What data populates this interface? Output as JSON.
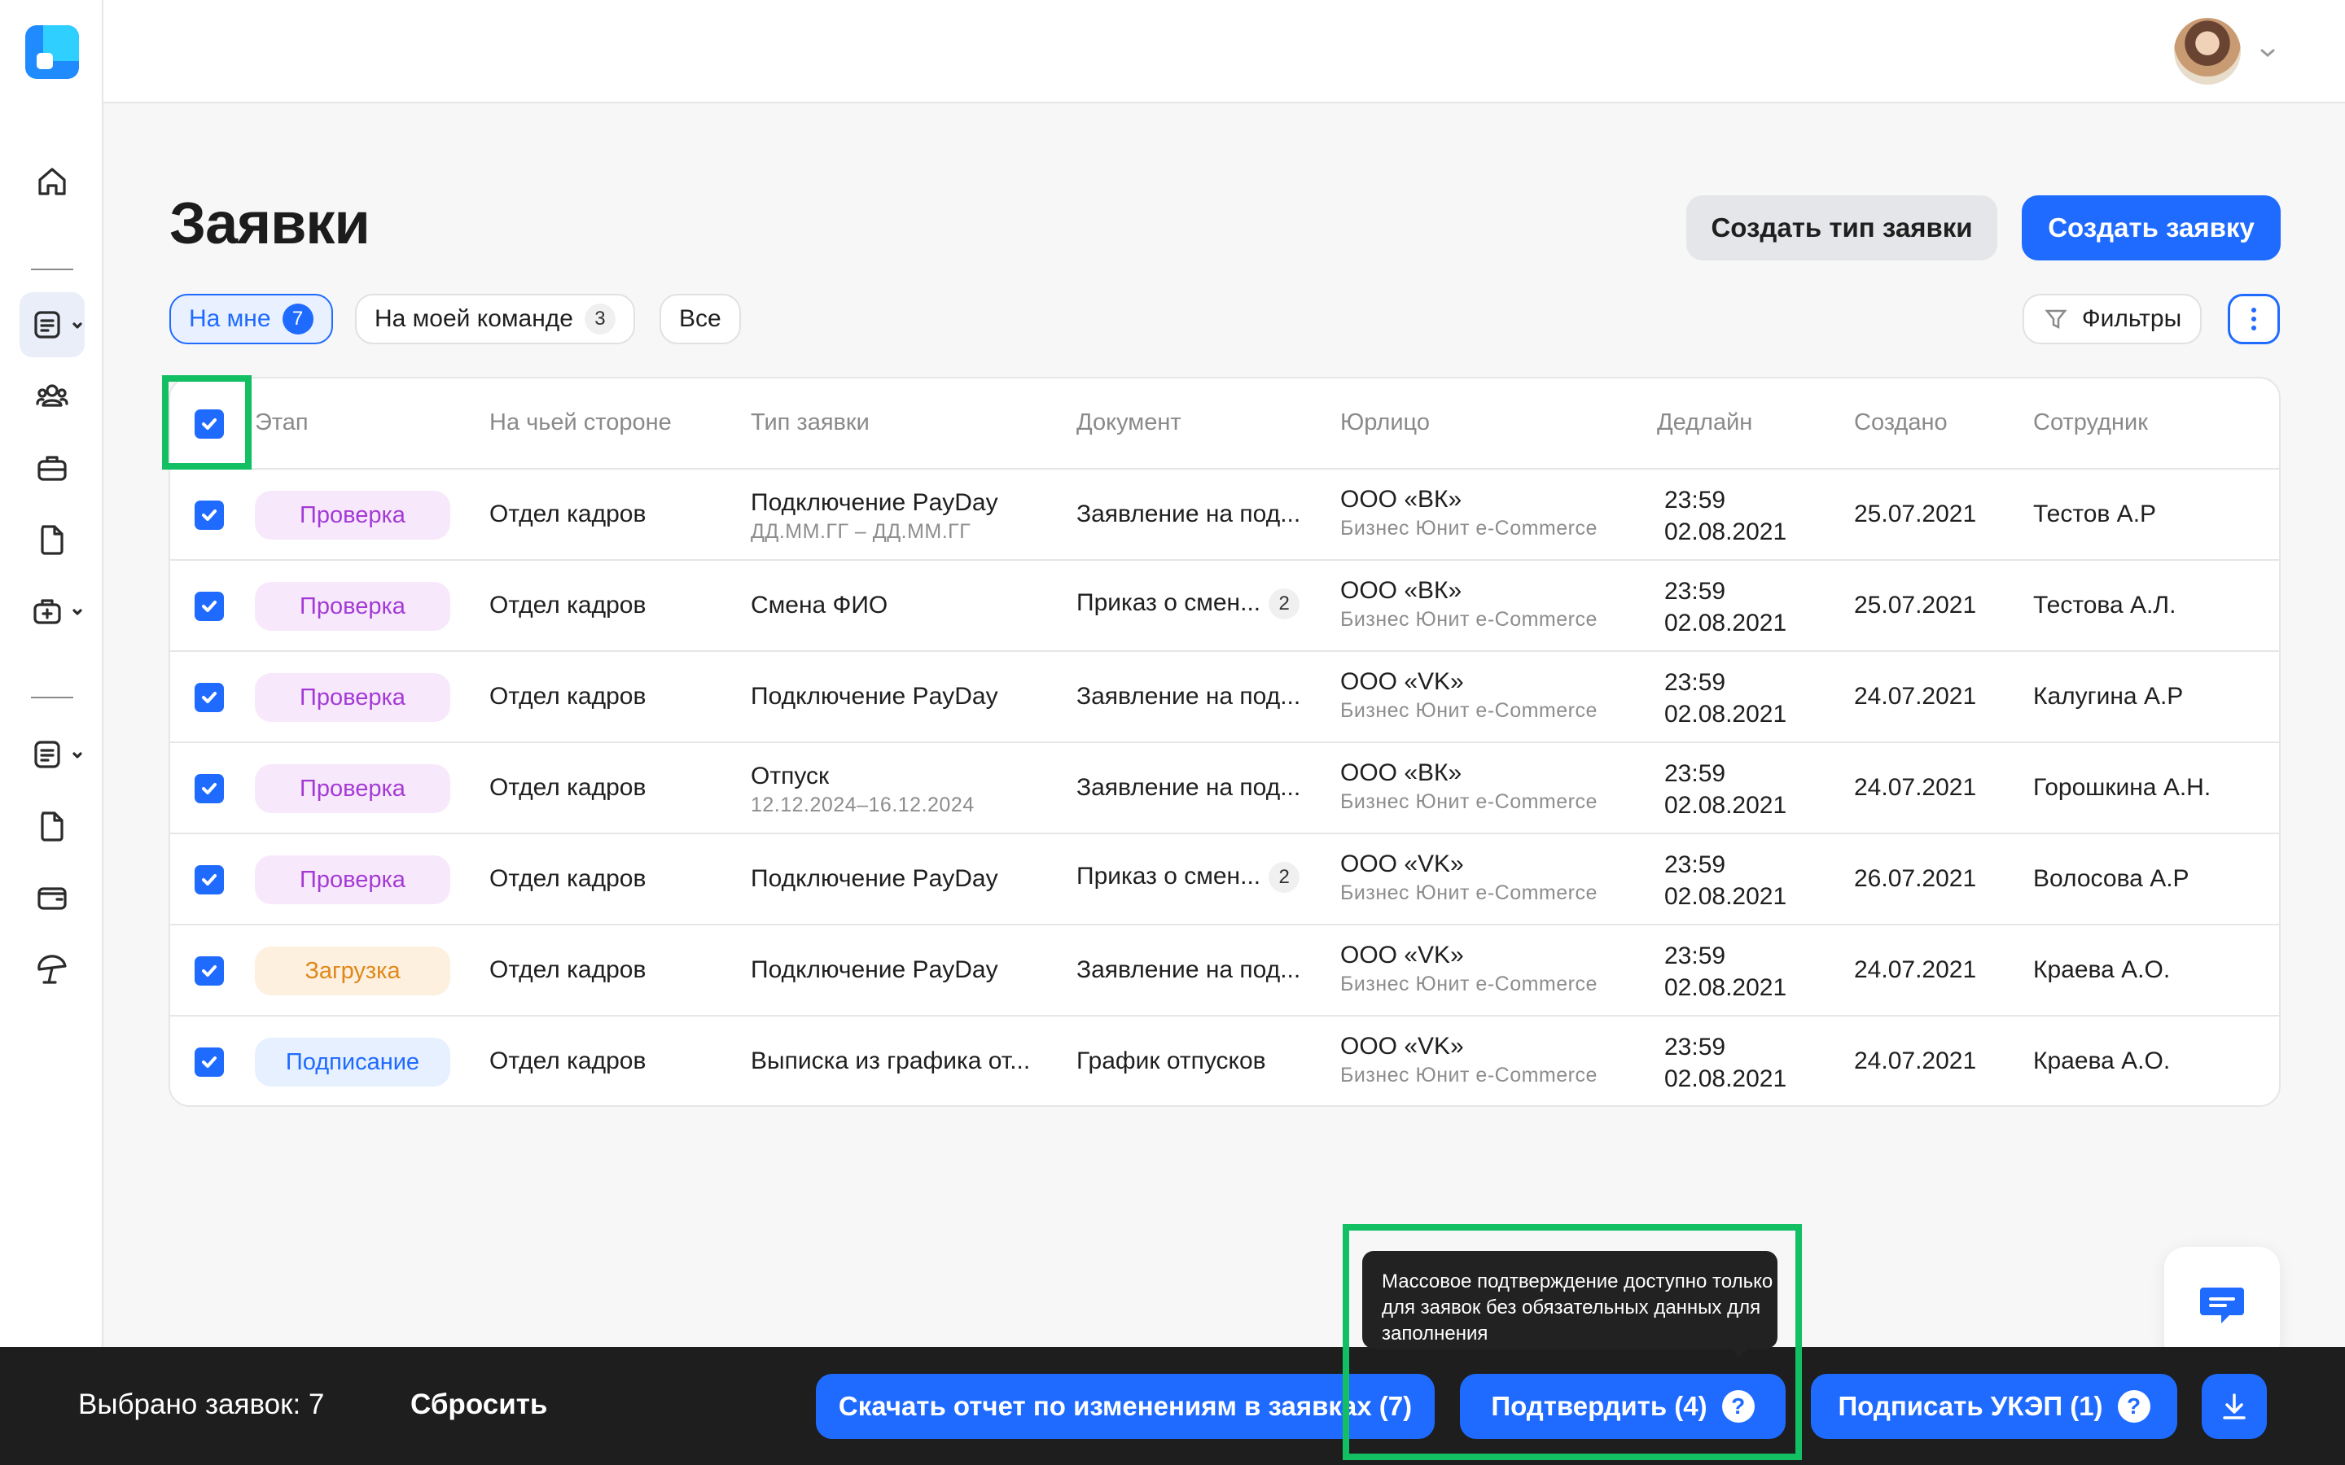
{
  "title": "Заявки",
  "header": {
    "create_type_label": "Создать тип заявки",
    "create_label": "Создать заявку"
  },
  "tabs": [
    {
      "label": "На мне",
      "count": "7"
    },
    {
      "label": "На моей команде",
      "count": "3"
    },
    {
      "label": "Все"
    }
  ],
  "filters_label": "Фильтры",
  "columns": [
    "Этап",
    "На чьей стороне",
    "Тип заявки",
    "Документ",
    "Юрлицо",
    "Дедлайн",
    "Создано",
    "Сотрудник"
  ],
  "rows": [
    {
      "stage": "Проверка",
      "side": "Отдел кадров",
      "type": "Подключение PayDay",
      "type_sub": "ДД.ММ.ГГ – ДД.ММ.ГГ",
      "doc": "Заявление на под...",
      "doc_count": "",
      "org": "ООО «ВК»",
      "org_sub": "Бизнес Юнит e-Commerce",
      "deadline_time": "23:59",
      "deadline_date": "02.08.2021",
      "created": "25.07.2021",
      "employee": "Тестов А.Р"
    },
    {
      "stage": "Проверка",
      "side": "Отдел кадров",
      "type": "Смена ФИО",
      "type_sub": "",
      "doc": "Приказ о смен...",
      "doc_count": "2",
      "org": "ООО «ВК»",
      "org_sub": "Бизнес Юнит e-Commerce",
      "deadline_time": "23:59",
      "deadline_date": "02.08.2021",
      "created": "25.07.2021",
      "employee": "Тестова А.Л."
    },
    {
      "stage": "Проверка",
      "side": "Отдел кадров",
      "type": "Подключение PayDay",
      "type_sub": "",
      "doc": "Заявление на под...",
      "doc_count": "",
      "org": "ООО «VK»",
      "org_sub": "Бизнес Юнит e-Commerce",
      "deadline_time": "23:59",
      "deadline_date": "02.08.2021",
      "created": "24.07.2021",
      "employee": "Калугина А.Р"
    },
    {
      "stage": "Проверка",
      "side": "Отдел кадров",
      "type": "Отпуск",
      "type_sub": "12.12.2024–16.12.2024",
      "doc": "Заявление на под...",
      "doc_count": "",
      "org": "ООО «ВК»",
      "org_sub": "Бизнес Юнит e-Commerce",
      "deadline_time": "23:59",
      "deadline_date": "02.08.2021",
      "created": "24.07.2021",
      "employee": "Горошкина А.Н."
    },
    {
      "stage": "Проверка",
      "side": "Отдел кадров",
      "type": "Подключение PayDay",
      "type_sub": "",
      "doc": "Приказ о смен...",
      "doc_count": "2",
      "org": "ООО «VK»",
      "org_sub": "Бизнес Юнит e-Commerce",
      "deadline_time": "23:59",
      "deadline_date": "02.08.2021",
      "created": "26.07.2021",
      "employee": "Волосова А.Р"
    },
    {
      "stage": "Загрузка",
      "side": "Отдел кадров",
      "type": "Подключение PayDay",
      "type_sub": "",
      "doc": "Заявление на под...",
      "doc_count": "",
      "org": "ООО «VK»",
      "org_sub": "Бизнес Юнит e-Commerce",
      "deadline_time": "23:59",
      "deadline_date": "02.08.2021",
      "created": "24.07.2021",
      "employee": "Краева А.О."
    },
    {
      "stage": "Подписание",
      "side": "Отдел кадров",
      "type": "Выписка из графика от...",
      "type_sub": "",
      "doc": "График отпусков",
      "doc_count": "",
      "org": "ООО «VK»",
      "org_sub": "Бизнес Юнит e-Commerce",
      "deadline_time": "23:59",
      "deadline_date": "02.08.2021",
      "created": "24.07.2021",
      "employee": "Краева А.О."
    }
  ],
  "bottom": {
    "selected_label": "Выбрано заявок: 7",
    "reset_label": "Сбросить",
    "report_label": "Скачать отчет по изменениям в заявках (7)",
    "confirm_label": "Подтвердить (4)",
    "sign_label": "Подписать УКЭП (1)",
    "tooltip": "Массовое подтверждение доступно только для заявок без обязательных данных для заполнения"
  },
  "colors": {
    "accent": "#1f6bff",
    "highlight": "#12c063",
    "stage_check": "#a43ad6",
    "stage_load": "#e0881a",
    "stage_sign": "#1f6bff"
  }
}
